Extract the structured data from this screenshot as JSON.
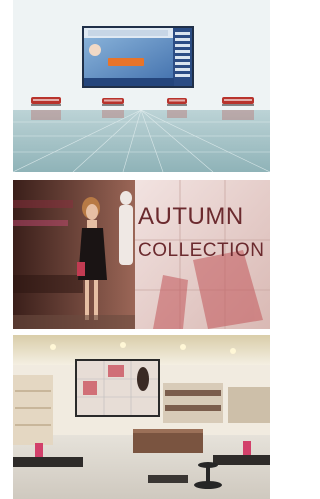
{
  "panels": [
    {
      "name": "airport-digital-signage",
      "screen": {
        "headline": "",
        "cta": ""
      }
    },
    {
      "name": "fashion-store-video-wall",
      "wall_text": {
        "line1": "AUTUMN",
        "line2": "COLLECTION"
      }
    },
    {
      "name": "retail-store-interior"
    }
  ]
}
